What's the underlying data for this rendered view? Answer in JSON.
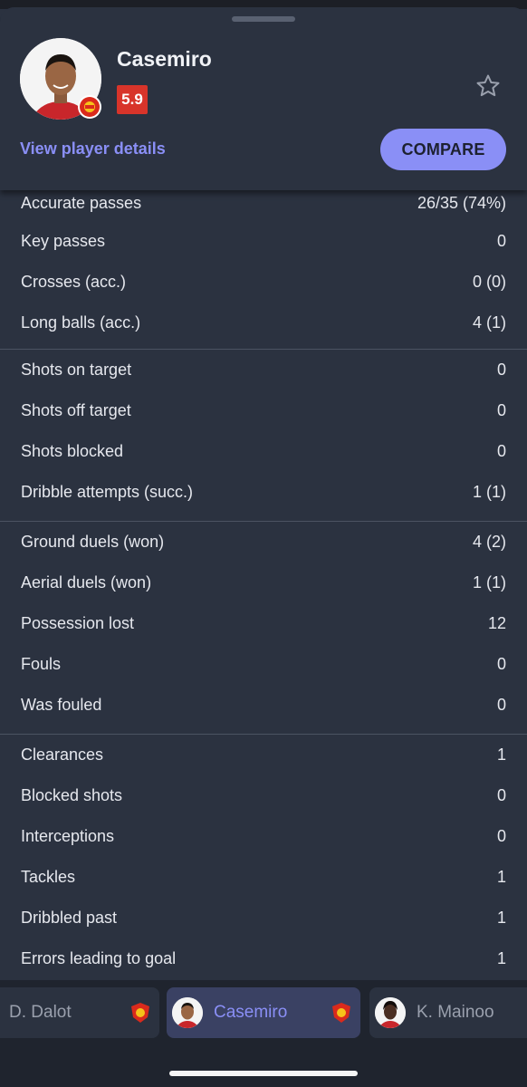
{
  "player": {
    "name": "Casemiro",
    "rating": "5.9",
    "details_link": "View player details",
    "compare_label": "COMPARE"
  },
  "stat_groups": [
    [
      {
        "label": "Accurate passes",
        "value": "26/35 (74%)"
      },
      {
        "label": "Key passes",
        "value": "0"
      },
      {
        "label": "Crosses (acc.)",
        "value": "0 (0)"
      },
      {
        "label": "Long balls (acc.)",
        "value": "4 (1)"
      }
    ],
    [
      {
        "label": "Shots on target",
        "value": "0"
      },
      {
        "label": "Shots off target",
        "value": "0"
      },
      {
        "label": "Shots blocked",
        "value": "0"
      },
      {
        "label": "Dribble attempts (succ.)",
        "value": "1 (1)"
      }
    ],
    [
      {
        "label": "Ground duels (won)",
        "value": "4 (2)"
      },
      {
        "label": "Aerial duels (won)",
        "value": "1 (1)"
      },
      {
        "label": "Possession lost",
        "value": "12"
      },
      {
        "label": "Fouls",
        "value": "0"
      },
      {
        "label": "Was fouled",
        "value": "0"
      }
    ],
    [
      {
        "label": "Clearances",
        "value": "1"
      },
      {
        "label": "Blocked shots",
        "value": "0"
      },
      {
        "label": "Interceptions",
        "value": "0"
      },
      {
        "label": "Tackles",
        "value": "1"
      },
      {
        "label": "Dribbled past",
        "value": "1"
      },
      {
        "label": "Errors leading to goal",
        "value": "1"
      }
    ]
  ],
  "tabs": [
    {
      "label": "D. Dalot",
      "active": false
    },
    {
      "label": "Casemiro",
      "active": true
    },
    {
      "label": "K. Mainoo",
      "active": false
    }
  ],
  "colors": {
    "accent": "#8a8ff6",
    "rating_bg": "#d8342a",
    "background": "#2b3240"
  },
  "icons": {
    "favorite": "star-outline-icon",
    "club": "manchester-united-crest-icon"
  }
}
